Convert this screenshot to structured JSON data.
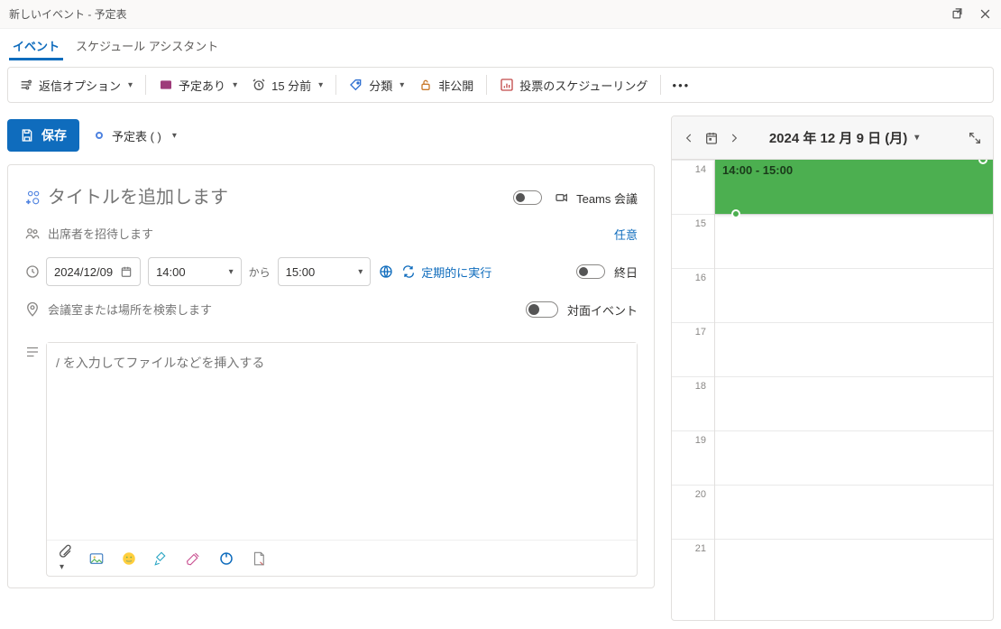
{
  "window": {
    "title": "新しいイベント - 予定表"
  },
  "tabs": {
    "event": "イベント",
    "scheduling": "スケジュール アシスタント"
  },
  "toolbar": {
    "response_options": "返信オプション",
    "show_as": "予定あり",
    "reminder": "15 分前",
    "categorize": "分類",
    "private": "非公開",
    "poll": "投票のスケジューリング"
  },
  "actions": {
    "save": "保存",
    "calendar_label": "予定表 (                                    )"
  },
  "form": {
    "title_placeholder": "タイトルを追加します",
    "teams": "Teams 会議",
    "attendee_placeholder": "出席者を招待します",
    "optional": "任意",
    "date": "2024/12/09",
    "start_time": "14:00",
    "end_time": "15:00",
    "between": "から",
    "recurring": "定期的に実行",
    "all_day": "終日",
    "location_placeholder": "会議室または場所を検索します",
    "in_person": "対面イベント",
    "body_placeholder": "/ を入力してファイルなどを挿入する"
  },
  "daypane": {
    "date_label": "2024 年 12 月 9 日 (月)",
    "hours": [
      "14",
      "15",
      "16",
      "17",
      "18",
      "19",
      "20",
      "21"
    ],
    "event_label": "14:00 - 15:00"
  }
}
